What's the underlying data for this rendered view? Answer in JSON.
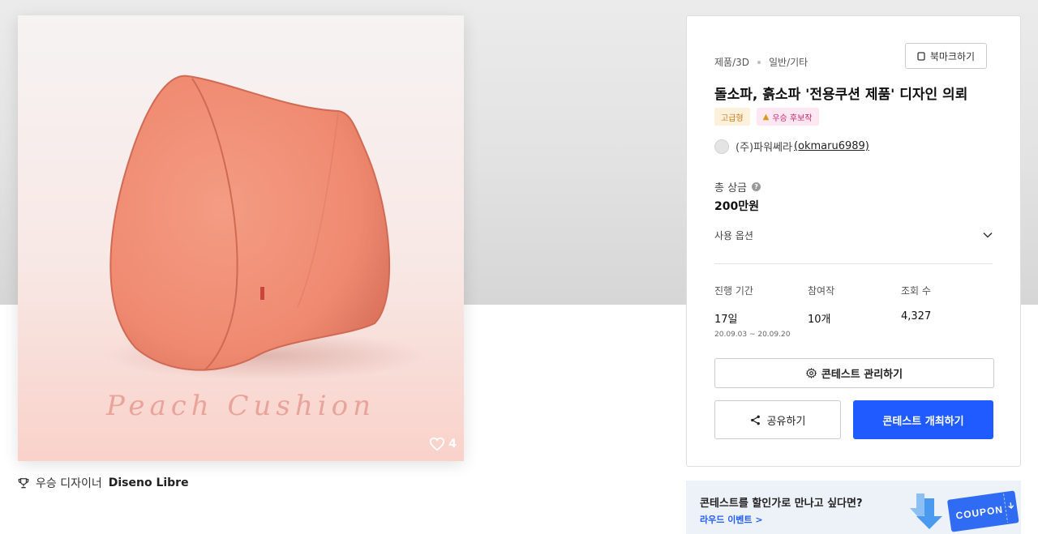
{
  "product": {
    "image_text": "Peach Cushion",
    "likes": "4",
    "winner_label": "우승 디자이너",
    "winner_name": "Diseno Libre"
  },
  "contest": {
    "category": "제품/3D",
    "subcategory": "일반/기타",
    "bookmark_label": "북마크하기",
    "title": "돌소파, 흙소파 '전용쿠션 제품' 디자인 의뢰",
    "badges": [
      "고급형",
      "우승 후보작"
    ],
    "host_name": "(주)파워쎄라",
    "host_id": "(okmaru6989)",
    "prize_label": "총 상금",
    "prize_value": "200만원",
    "options_label": "사용 옵션",
    "stats": [
      {
        "label": "진행 기간",
        "value": "17일",
        "sub": "20.09.03 ~ 20.09.20"
      },
      {
        "label": "참여작",
        "value": "10개",
        "sub": ""
      },
      {
        "label": "조회 수",
        "value": "4,327",
        "sub": ""
      }
    ],
    "manage_label": "콘테스트 관리하기",
    "share_label": "공유하기",
    "host_contest_label": "콘테스트 개최하기"
  },
  "promo": {
    "title": "콘테스트를 할인가로 만나고 싶다면?",
    "link": "라우드 이벤트 >",
    "coupon_text": "COUPON"
  },
  "colors": {
    "accent": "#1f5bff",
    "peach": "#f08870"
  }
}
